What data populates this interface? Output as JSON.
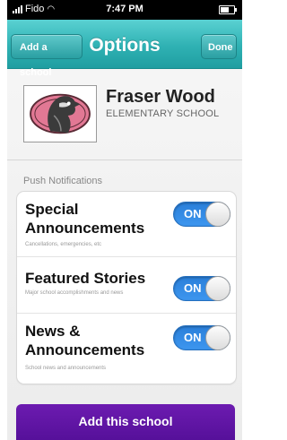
{
  "status_bar": {
    "carrier": "Fido",
    "time": "7:47 PM"
  },
  "nav": {
    "back_label": "Add a school",
    "title": "Options",
    "done_label": "Done"
  },
  "school": {
    "name": "Fraser Wood",
    "type": "ELEMENTARY SCHOOL",
    "logo_icon": "falcon-crest-icon"
  },
  "push_notifications": {
    "section_title": "Push Notifications",
    "items": [
      {
        "title_line1": "Special",
        "title_line2": "Announcements",
        "subtitle": "Cancellations, emergencies, etc",
        "toggle": "ON",
        "enabled": true
      },
      {
        "title_line1": "Featured Stories",
        "title_line2": "",
        "subtitle": "Major school accomplishments and news",
        "toggle": "ON",
        "enabled": true
      },
      {
        "title_line1": "News &",
        "title_line2": "Announcements",
        "subtitle": "School news and announcements",
        "toggle": "ON",
        "enabled": true
      }
    ]
  },
  "add_button": "Add this school",
  "colors": {
    "nav": "#2fb1b3",
    "toggle_on": "#3d96ef",
    "add_button": "#5e14a2"
  }
}
